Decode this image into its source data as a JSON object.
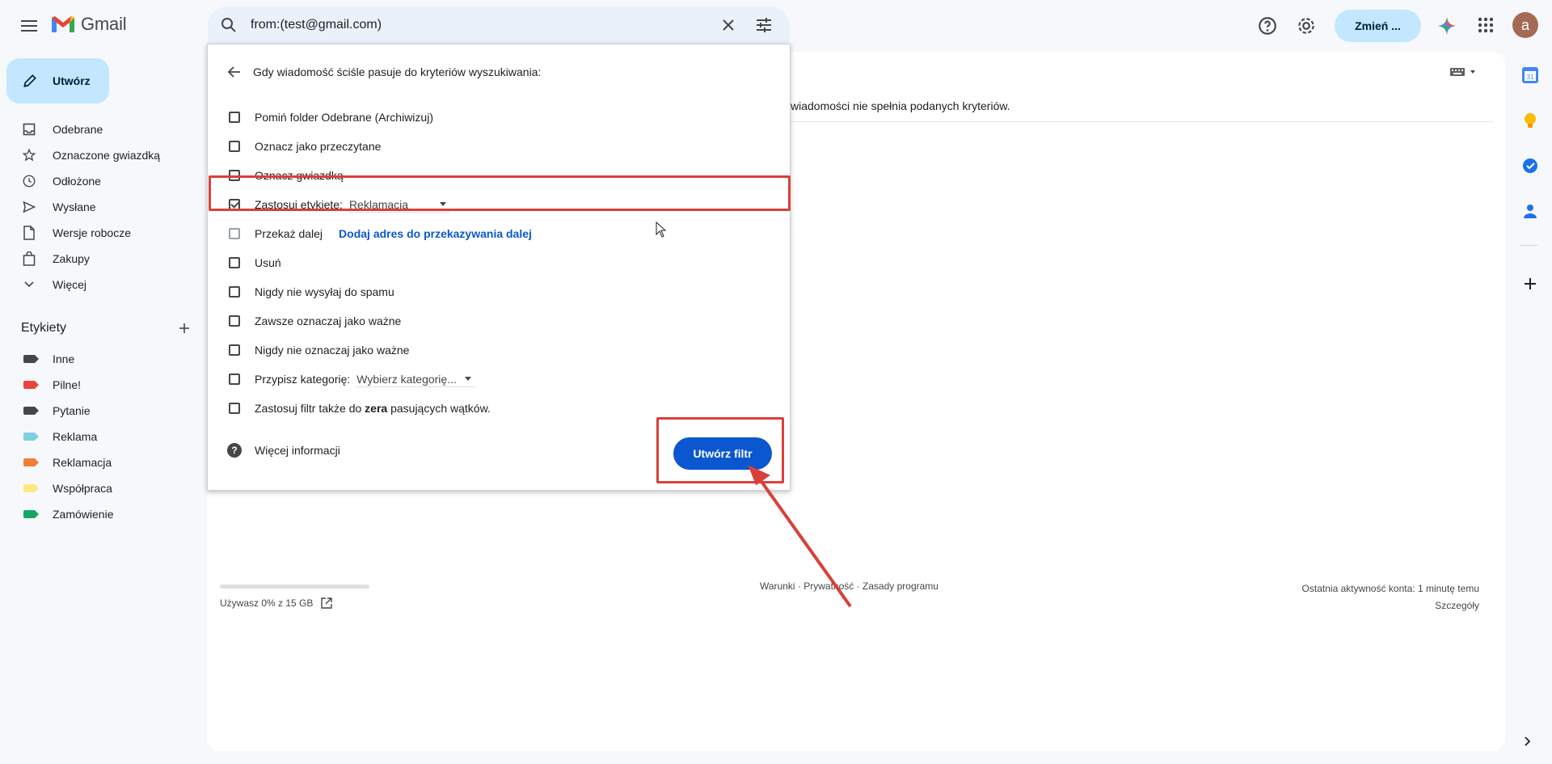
{
  "app": {
    "name": "Gmail"
  },
  "search": {
    "query": "from:(test@gmail.com)"
  },
  "header": {
    "upgrade_label": "Zmień ...",
    "avatar_letter": "a"
  },
  "compose": {
    "label": "Utwórz"
  },
  "nav": {
    "items": [
      {
        "label": "Odebrane",
        "icon": "inbox-icon"
      },
      {
        "label": "Oznaczone gwiazdką",
        "icon": "star-icon"
      },
      {
        "label": "Odłożone",
        "icon": "clock-icon"
      },
      {
        "label": "Wysłane",
        "icon": "send-icon"
      },
      {
        "label": "Wersje robocze",
        "icon": "draft-icon"
      },
      {
        "label": "Zakupy",
        "icon": "shopping-bag-icon"
      },
      {
        "label": "Więcej",
        "icon": "chevron-down-icon"
      }
    ]
  },
  "labels": {
    "title": "Etykiety",
    "items": [
      {
        "label": "Inne",
        "color": "#444746"
      },
      {
        "label": "Pilne!",
        "color": "#e8453c"
      },
      {
        "label": "Pytanie",
        "color": "#444746"
      },
      {
        "label": "Reklama",
        "color": "#7fcfe0"
      },
      {
        "label": "Reklamacja",
        "color": "#f27e37"
      },
      {
        "label": "Współpraca",
        "color": "#fbe983"
      },
      {
        "label": "Zamówienie",
        "color": "#16a765"
      }
    ]
  },
  "main": {
    "message": "wiadomości nie spełnia podanych kryteriów.",
    "storage": "Używasz 0% z 15 GB",
    "footer_links": "Warunki · Prywatność · Zasady programu",
    "activity": "Ostatnia aktywność konta: 1 minutę temu",
    "details": "Szczegóły"
  },
  "filter_dialog": {
    "header": "Gdy wiadomość ściśle pasuje do kryteriów wyszukiwania:",
    "options": {
      "skip_inbox": "Pomiń folder Odebrane (Archiwizuj)",
      "mark_read": "Oznacz jako przeczytane",
      "star": "Oznacz gwiazdką",
      "apply_label": "Zastosuj etykietę:",
      "apply_label_value": "Reklamacja",
      "forward": "Przekaż dalej",
      "forward_link": "Dodaj adres do przekazywania dalej",
      "delete": "Usuń",
      "never_spam": "Nigdy nie wysyłaj do spamu",
      "always_important": "Zawsze oznaczaj jako ważne",
      "never_important": "Nigdy nie oznaczaj jako ważne",
      "category": "Przypisz kategorię:",
      "category_value": "Wybierz kategorię...",
      "also_apply_pre": "Zastosuj filtr także do ",
      "also_apply_bold": "zera",
      "also_apply_post": " pasujących wątków."
    },
    "checked": {
      "apply_label": true
    },
    "more_info": "Więcej informacji",
    "create_button": "Utwórz filtr"
  },
  "annotation": {
    "color": "#d9403a"
  }
}
